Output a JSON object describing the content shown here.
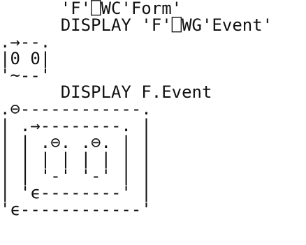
{
  "session": {
    "lines": [
      "      'F'⎕WC'Form'",
      "      DISPLAY 'F'⎕WG'Event'",
      ".→--.",
      "|0 0|",
      "'~--'",
      "      DISPLAY F.Event",
      ".⊖------------.",
      "| .→--------. |",
      "| | .⊖. .⊖. | |",
      "| | | | | | | |",
      "| | '-' '-' | |",
      "| 'ϵ--------' |",
      "'ϵ------------'"
    ]
  }
}
